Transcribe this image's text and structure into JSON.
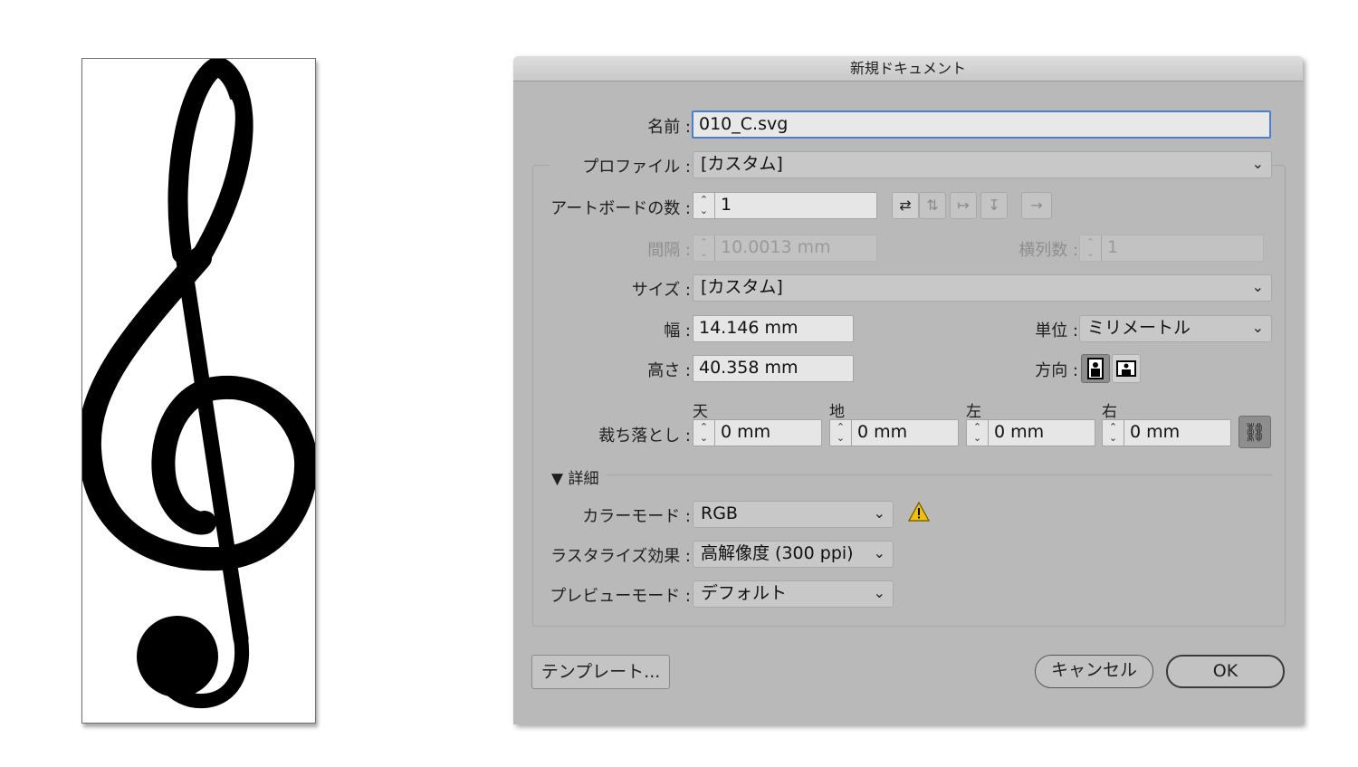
{
  "dialog": {
    "title": "新規ドキュメント",
    "name_label": "名前 :",
    "name_value": "010_C.svg",
    "profile_label": "プロファイル :",
    "profile_value": "[カスタム]",
    "artboards_label": "アートボードの数 :",
    "artboards_value": "1",
    "spacing_label": "間隔 :",
    "spacing_value": "10.0013 mm",
    "columns_label": "横列数 :",
    "columns_value": "1",
    "size_label": "サイズ :",
    "size_value": "[カスタム]",
    "width_label": "幅 :",
    "width_value": "14.146 mm",
    "units_label": "単位 :",
    "units_value": "ミリメートル",
    "height_label": "高さ :",
    "height_value": "40.358 mm",
    "orientation_label": "方向 :",
    "bleed_label": "裁ち落とし :",
    "bleed": {
      "top_label": "天",
      "top_value": "0 mm",
      "bottom_label": "地",
      "bottom_value": "0 mm",
      "left_label": "左",
      "left_value": "0 mm",
      "right_label": "右",
      "right_value": "0 mm"
    },
    "advanced_label": "詳細",
    "color_mode_label": "カラーモード :",
    "color_mode_value": "RGB",
    "raster_label": "ラスタライズ効果 :",
    "raster_value": "高解像度 (300 ppi)",
    "preview_label": "プレビューモード :",
    "preview_value": "デフォルト",
    "template_button": "テンプレート...",
    "cancel_button": "キャンセル",
    "ok_button": "OK"
  },
  "icons": {
    "arrange_icons": [
      "grid-by-row-icon",
      "grid-by-column-icon",
      "arrange-by-row-icon",
      "arrange-by-column-icon"
    ],
    "ltr_arrow": "→",
    "chevron": "⌄",
    "warning": "warning-icon",
    "link": "link-icon"
  },
  "colors": {
    "dialog_bg": "#b9b9b9",
    "focus_border": "#4a7fd0",
    "warning": "#f2c200"
  }
}
